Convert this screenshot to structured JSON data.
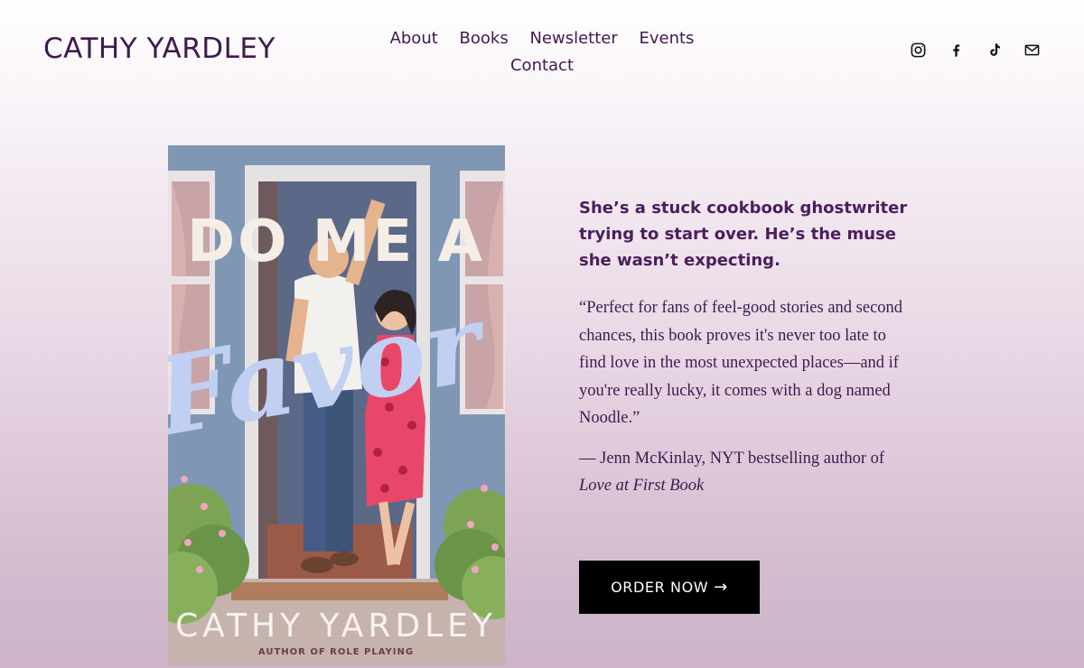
{
  "header": {
    "site_title": "CATHY YARDLEY",
    "nav": [
      {
        "label": "About"
      },
      {
        "label": "Books"
      },
      {
        "label": "Newsletter"
      },
      {
        "label": "Events"
      },
      {
        "label": "Contact"
      }
    ],
    "social_icons": [
      "instagram-icon",
      "facebook-icon",
      "tiktok-icon",
      "email-icon"
    ]
  },
  "book": {
    "cover_title_top": "DO ME A",
    "cover_title_script": "Favor",
    "cover_author": "CATHY YARDLEY",
    "cover_tagline": "AUTHOR OF ROLE PLAYING"
  },
  "main": {
    "pitch": "She’s a stuck cookbook ghostwriter trying to start over. He’s the muse she wasn’t expecting.",
    "quote": "“Perfect for fans of feel-good stories and second chances, this book proves it's never too late to find love in the most unexpected places—and if you're really lucky, it comes with a dog named Noodle.”",
    "attribution": "— Jenn McKinlay, NYT bestselling author of",
    "attribution_book": "Love at First Book",
    "cta_label": "ORDER NOW",
    "cta_arrow": "→"
  },
  "colors": {
    "text": "#3e1a4f",
    "button_bg": "#000000",
    "button_text": "#ffffff"
  }
}
